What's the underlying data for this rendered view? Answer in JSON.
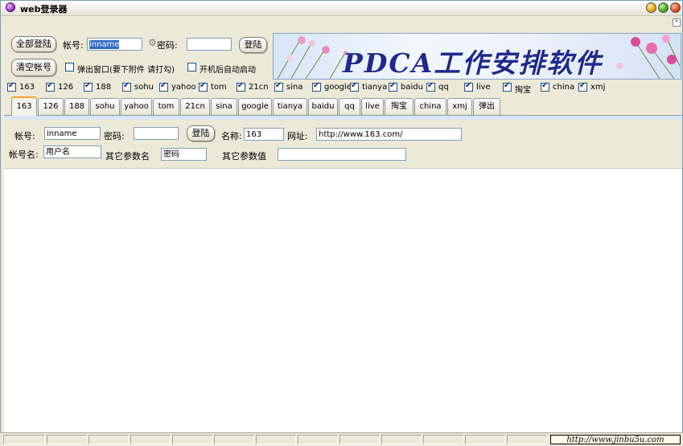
{
  "window": {
    "title": "web登录器"
  },
  "toolbar": {
    "login_all": "全部登陆",
    "clear_accounts": "清空帐号",
    "account_label": "帐号:",
    "account_value": "inname",
    "password_label": "密码:",
    "password_value": "",
    "login": "登陆",
    "popup_window": "弹出窗口(要下附件 请打勾)",
    "autostart": "开机后自动启动"
  },
  "banner": {
    "text": "PDCA工作安排软件"
  },
  "sites": [
    {
      "label": "163",
      "checked": true
    },
    {
      "label": "126",
      "checked": true
    },
    {
      "label": "188",
      "checked": true
    },
    {
      "label": "sohu",
      "checked": true
    },
    {
      "label": "yahoo",
      "checked": true
    },
    {
      "label": "tom",
      "checked": true
    },
    {
      "label": "21cn",
      "checked": true
    },
    {
      "label": "sina",
      "checked": true
    },
    {
      "label": "google",
      "checked": true
    },
    {
      "label": "tianya",
      "checked": true
    },
    {
      "label": "baidu",
      "checked": true
    },
    {
      "label": "qq",
      "checked": true
    },
    {
      "label": "live",
      "checked": true
    },
    {
      "label": "掏宝",
      "checked": true
    },
    {
      "label": "china",
      "checked": true
    },
    {
      "label": "xmj",
      "checked": true
    }
  ],
  "tabs": [
    "163",
    "126",
    "188",
    "sohu",
    "yahoo",
    "tom",
    "21cn",
    "sina",
    "google",
    "tianya",
    "baidu",
    "qq",
    "live",
    "掏宝",
    "china",
    "xmj",
    "弹出"
  ],
  "active_tab": "163",
  "detail": {
    "account_label": "帐号:",
    "account_value": "inname",
    "password_label": "密码:",
    "password_value": "",
    "login": "登陆",
    "name_label": "名称:",
    "name_value": "163",
    "url_label": "网址:",
    "url_value": "http://www.163.com/",
    "username_label": "帐号名:",
    "username_value": "用户名",
    "param_name_label": "其它参数名",
    "param_name_value": "密码",
    "param_value_label": "其它参数值",
    "param_value_value": ""
  },
  "status": {
    "watermark": "http://www.jinbu5u.com"
  }
}
